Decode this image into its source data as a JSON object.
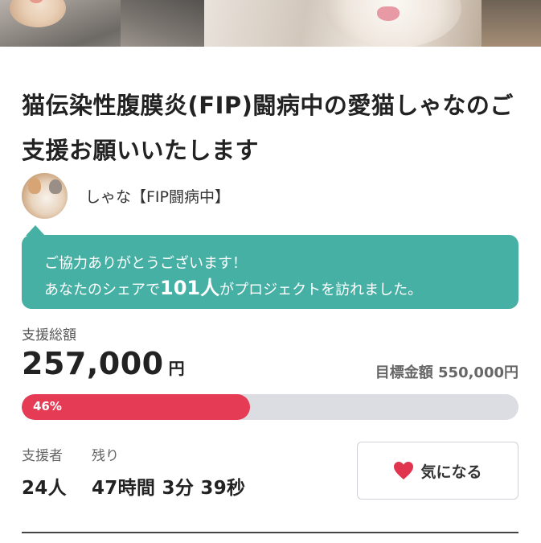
{
  "project": {
    "title": "猫伝染性腹膜炎(FIP)闘病中の愛猫しゃなのご支援お願いいたします"
  },
  "owner": {
    "name": "しゃな【FIP闘病中】"
  },
  "share_message": {
    "line1": "ご協力ありがとうございます！",
    "line2_prefix": "あなたのシェアで",
    "count": "101人",
    "line2_suffix": "がプロジェクトを訪れました。"
  },
  "funding": {
    "total_label": "支援総額",
    "total_amount": "257,000",
    "currency": "円",
    "goal_label": "目標金額",
    "goal_amount": "550,000円",
    "progress_percent": 46,
    "progress_text": "46%"
  },
  "stats": {
    "backers_label": "支援者",
    "backers_value": "24人",
    "remaining_label": "残り",
    "remaining_value": "47時間 3分 39秒"
  },
  "favorite_button": {
    "label": "気になる",
    "icon": "heart-icon"
  },
  "colors": {
    "accent_teal": "#46b0a4",
    "progress_red": "#e53b55",
    "heart_red": "#e0344f"
  }
}
